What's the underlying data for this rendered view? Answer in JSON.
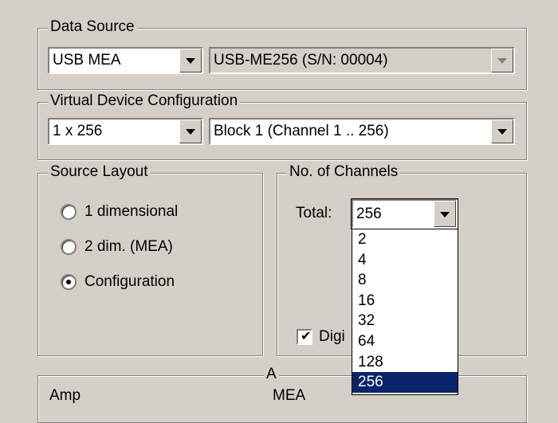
{
  "data_source": {
    "legend": "Data Source",
    "type_value": "USB MEA",
    "device_value": "USB-ME256  (S/N: 00004)"
  },
  "virtual_device": {
    "legend": "Virtual Device Configuration",
    "config_value": "1 x 256",
    "block_value": "Block 1 (Channel 1 .. 256)"
  },
  "source_layout": {
    "legend": "Source Layout",
    "options": [
      {
        "label": "1 dimensional",
        "checked": false
      },
      {
        "label": "2 dim. (MEA)",
        "checked": false
      },
      {
        "label": "Configuration",
        "checked": true
      }
    ]
  },
  "channels": {
    "legend": "No. of Channels",
    "total_label": "Total:",
    "total_value": "256",
    "options": [
      "2",
      "4",
      "8",
      "16",
      "32",
      "64",
      "128",
      "256"
    ],
    "selected_option": "256",
    "digital_label": "Digi",
    "digital_checked": true
  },
  "bottom_group": {
    "legend": "A",
    "amp_label": "Amp",
    "mea_label": "MEA"
  }
}
